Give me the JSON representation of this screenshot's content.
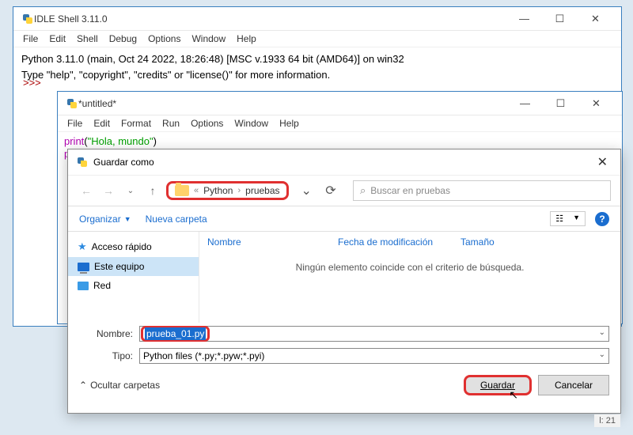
{
  "shell": {
    "title": "IDLE Shell 3.11.0",
    "menu": [
      "File",
      "Edit",
      "Shell",
      "Debug",
      "Options",
      "Window",
      "Help"
    ],
    "line1": "Python 3.11.0 (main, Oct 24 2022, 18:26:48) [MSC v.1933 64 bit (AMD64)] on win32",
    "line2": "Type \"help\", \"copyright\", \"credits\" or \"license()\" for more information.",
    "prompt": ">>>"
  },
  "editor": {
    "title": "*untitled*",
    "menu": [
      "File",
      "Edit",
      "Format",
      "Run",
      "Options",
      "Window",
      "Help"
    ],
    "code_kw": "print",
    "code_str": "\"Hola, mundo\"",
    "code_partial": "pri"
  },
  "dialog": {
    "title": "Guardar como",
    "breadcrumb_sep": "«",
    "breadcrumb": [
      "Python",
      "pruebas"
    ],
    "bc_arrow": "›",
    "search_placeholder": "Buscar en pruebas",
    "organize": "Organizar",
    "new_folder": "Nueva carpeta",
    "nav_items": {
      "quick": "Acceso rápido",
      "pc": "Este equipo",
      "network": "Red"
    },
    "columns": {
      "name": "Nombre",
      "date": "Fecha de modificación",
      "size": "Tamaño"
    },
    "empty": "Ningún elemento coincide con el criterio de búsqueda.",
    "name_label": "Nombre:",
    "filename": "prueba_01.py",
    "type_label": "Tipo:",
    "type_value": "Python files (*.py;*.pyw;*.pyi)",
    "hide_folders": "Ocultar carpetas",
    "save_btn": "Guardar",
    "cancel_btn": "Cancelar"
  },
  "status": "l: 21"
}
